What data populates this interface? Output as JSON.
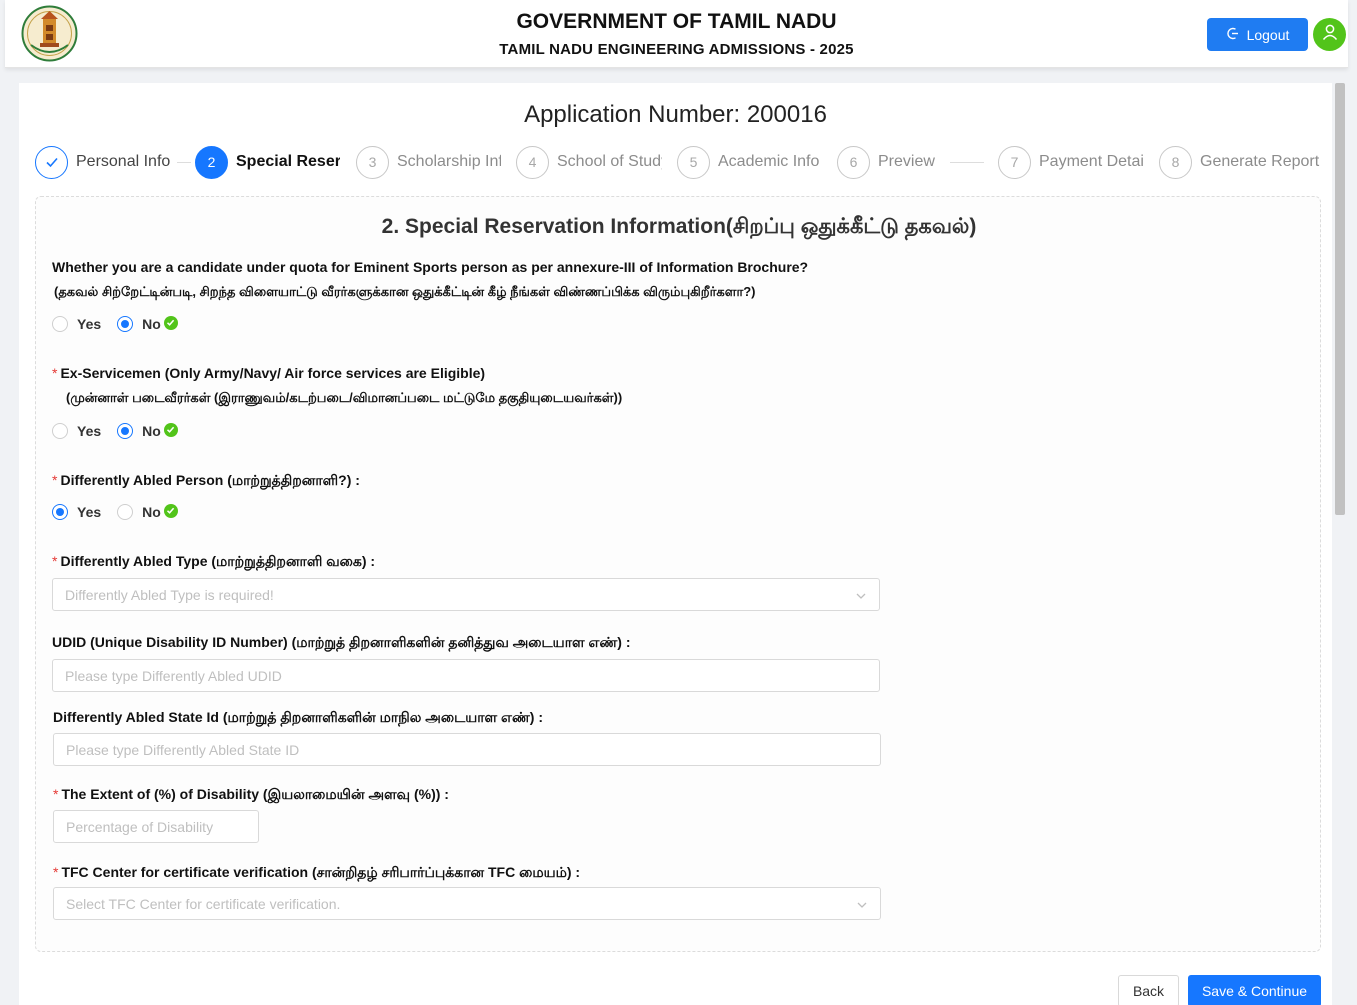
{
  "header": {
    "title": "GOVERNMENT OF TAMIL NADU",
    "subtitle": "TAMIL NADU ENGINEERING ADMISSIONS - 2025",
    "logout_label": "Logout"
  },
  "application_number": "Application Number: 200016",
  "steps": [
    {
      "number": "1",
      "label": "Personal Info",
      "state": "done"
    },
    {
      "number": "2",
      "label": "Special Reservation Info",
      "state": "active"
    },
    {
      "number": "3",
      "label": "Scholarship Info",
      "state": "pending"
    },
    {
      "number": "4",
      "label": "School of Study",
      "state": "pending"
    },
    {
      "number": "5",
      "label": "Academic Info",
      "state": "pending"
    },
    {
      "number": "6",
      "label": "Preview",
      "state": "pending"
    },
    {
      "number": "7",
      "label": "Payment Details",
      "state": "pending"
    },
    {
      "number": "8",
      "label": "Generate Report",
      "state": "pending"
    }
  ],
  "section": {
    "title": "2. Special Reservation Information(சிறப்பு ஒதுக்கீட்டு தகவல்)"
  },
  "questions": {
    "sports": {
      "label": "Whether you are a candidate under quota for Eminent Sports person as per annexure-III of Information Brochure?",
      "label_ta": "(தகவல் சிற்றேட்டின்படி, சிறந்த விளையாட்டு வீரர்களுக்கான ஒதுக்கீட்டின் கீழ் நீங்கள் விண்ணப்பிக்க விரும்புகிறீர்களா?)",
      "options": [
        "Yes",
        "No"
      ],
      "selected": "No"
    },
    "ex_servicemen": {
      "label": "Ex-Servicemen (Only Army/Navy/ Air force services are Eligible)",
      "label_ta": "(முன்னாள் படைவீரர்கள் (இராணுவம்/கடற்படை/விமானப்படை மட்டுமே தகுதியுடையவர்கள்))",
      "options": [
        "Yes",
        "No"
      ],
      "selected": "No"
    },
    "differently_abled": {
      "label": "Differently Abled Person (மாற்றுத்திறனாளி?) :",
      "options": [
        "Yes",
        "No"
      ],
      "selected": "Yes"
    },
    "differently_abled_type": {
      "label": "Differently Abled Type (மாற்றுத்திறனாளி வகை) :",
      "placeholder": "Differently Abled Type is required!"
    },
    "udid": {
      "label": "UDID (Unique Disability ID Number) (மாற்றுத் திறனாளிகளின் தனித்துவ அடையாள எண்) :",
      "placeholder": "Please type Differently Abled UDID"
    },
    "state_id": {
      "label": "Differently Abled State Id (மாற்றுத் திறனாளிகளின் மாநில அடையாள எண்) :",
      "placeholder": "Please type Differently Abled State ID"
    },
    "extent": {
      "label": "The Extent of (%) of Disability (இயலாமையின் அளவு (%)) :",
      "placeholder": "Percentage of Disability"
    },
    "tfc": {
      "label": "TFC Center for certificate verification (சான்றிதழ் சரிபார்ப்புக்கான TFC மையம்) :",
      "placeholder": "Select TFC Center for certificate verification."
    }
  },
  "buttons": {
    "back": "Back",
    "save": "Save & Continue"
  }
}
